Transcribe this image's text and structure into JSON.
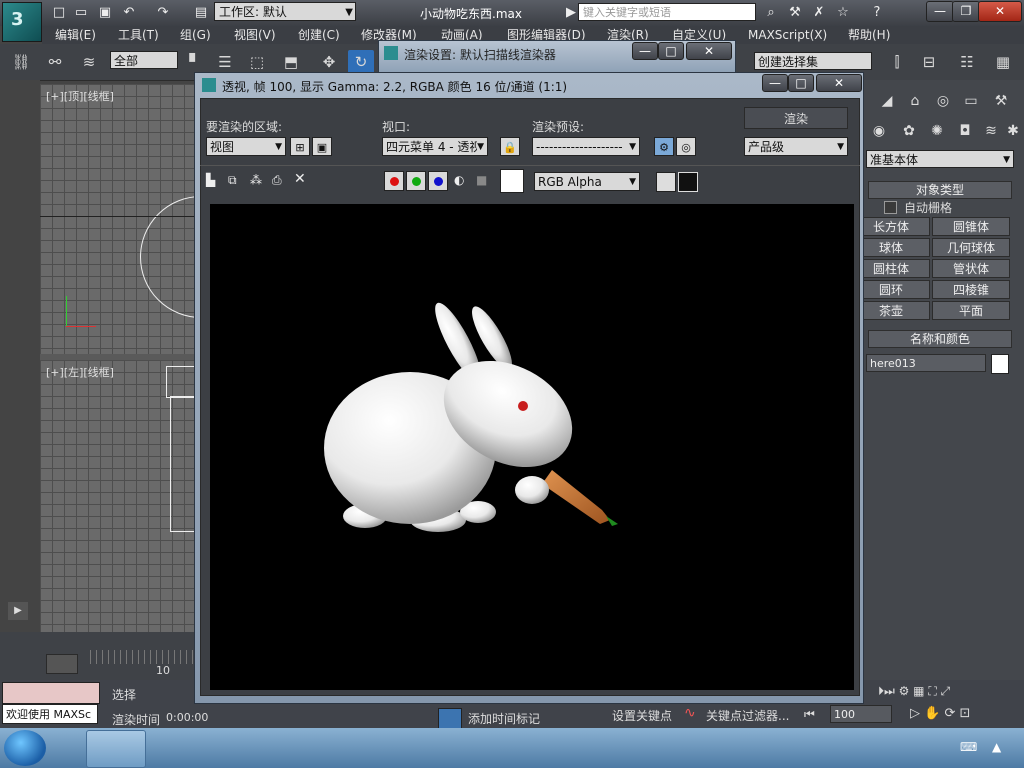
{
  "app": {
    "logo_text": "3"
  },
  "topbar": {
    "workspace_label": "工作区: 默认",
    "doc_title": "小动物吃东西.max",
    "search_placeholder": "键入关键字或短语"
  },
  "menu": [
    "编辑(E)",
    "工具(T)",
    "组(G)",
    "视图(V)",
    "创建(C)",
    "修改器(M)",
    "动画(A)",
    "图形编辑器(D)",
    "渲染(R)",
    "自定义(U)",
    "MAXScript(X)",
    "帮助(H)"
  ],
  "toolbar": {
    "selection_filter": "全部",
    "named_selection": "创建选择集"
  },
  "viewports": {
    "top_label": "[+][顶][线框]",
    "left_label": "[+][左][线框]"
  },
  "command_panel": {
    "category": "准基本体",
    "rollout_object_type": "对象类型",
    "autogrid": "自动栅格",
    "buttons": [
      "长方体",
      "圆锥体",
      "球体",
      "几何球体",
      "圆柱体",
      "管状体",
      "圆环",
      "四棱锥",
      "茶壶",
      "平面"
    ],
    "rollout_name_color": "名称和颜色",
    "object_name": "here013"
  },
  "background_dialog": {
    "title": "渲染设置: 默认扫描线渲染器"
  },
  "render_window": {
    "title": "透视, 帧 100, 显示 Gamma: 2.2, RGBA 颜色 16 位/通道 (1:1)",
    "area_label": "要渲染的区域:",
    "area_value": "视图",
    "viewport_label": "视口:",
    "viewport_value": "四元菜单 4 - 透视",
    "preset_label": "渲染预设:",
    "preset_value": "--------------------",
    "render_button": "渲染",
    "quality_value": "产品级",
    "channel_value": "RGB Alpha"
  },
  "timeline": {
    "tick_label": "10"
  },
  "status": {
    "select_label": "选择",
    "maxscript_text": "欢迎使用 MAXSc",
    "render_time_label": "渲染时间",
    "render_time_value": "0:00:00",
    "add_time_tag": "添加时间标记",
    "set_key": "设置关键点",
    "key_filter": "关键点过滤器...",
    "frame_value": "100"
  },
  "colors": {
    "accent": "#2b8d8f",
    "carrot": "#c77a3a",
    "eye": "#c81e1e"
  }
}
